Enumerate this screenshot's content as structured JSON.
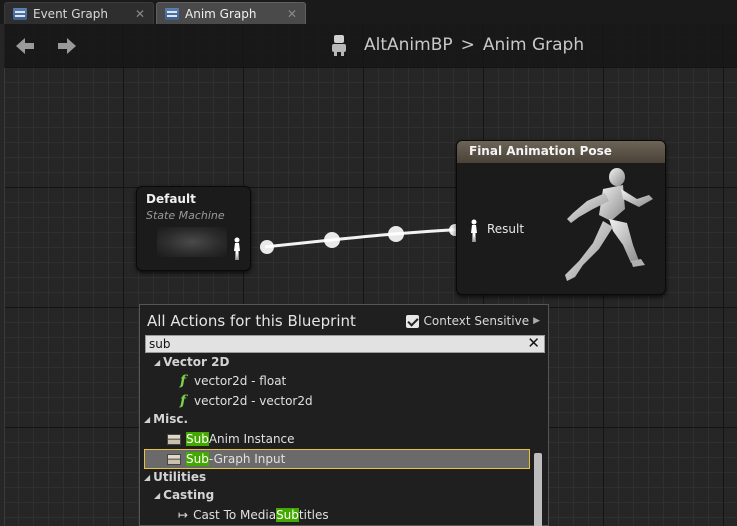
{
  "tabs": [
    {
      "label": "Event Graph",
      "active": false
    },
    {
      "label": "Anim Graph",
      "active": true
    }
  ],
  "header": {
    "blueprint": "AltAnimBP",
    "separator": ">",
    "graph": "Anim Graph"
  },
  "nodes": {
    "default": {
      "title": "Default",
      "subtitle": "State Machine"
    },
    "final": {
      "title": "Final Animation Pose",
      "pin_label": "Result",
      "header_color": "#6d6457"
    }
  },
  "menu": {
    "title": "All Actions for this Blueprint",
    "context_sensitive_label": "Context Sensitive",
    "context_sensitive_checked": true,
    "search_value": "sub",
    "categories": {
      "vector2d": "Vector 2D",
      "misc": "Misc.",
      "utilities": "Utilities",
      "casting": "Casting"
    },
    "items": {
      "vector2d_float": "vector2d - float",
      "vector2d_vector2d": "vector2d - vector2d",
      "sub_anim_instance": {
        "match": "Sub",
        "rest": " Anim Instance"
      },
      "sub_graph_input": {
        "match": "Sub",
        "rest": "-Graph Input"
      },
      "cast_media_subtitles": {
        "prefix": "Cast To Media",
        "match": "Sub",
        "rest": "titles"
      }
    },
    "highlight_color": "#43a800",
    "selection_border_color": "#e8c23c"
  }
}
